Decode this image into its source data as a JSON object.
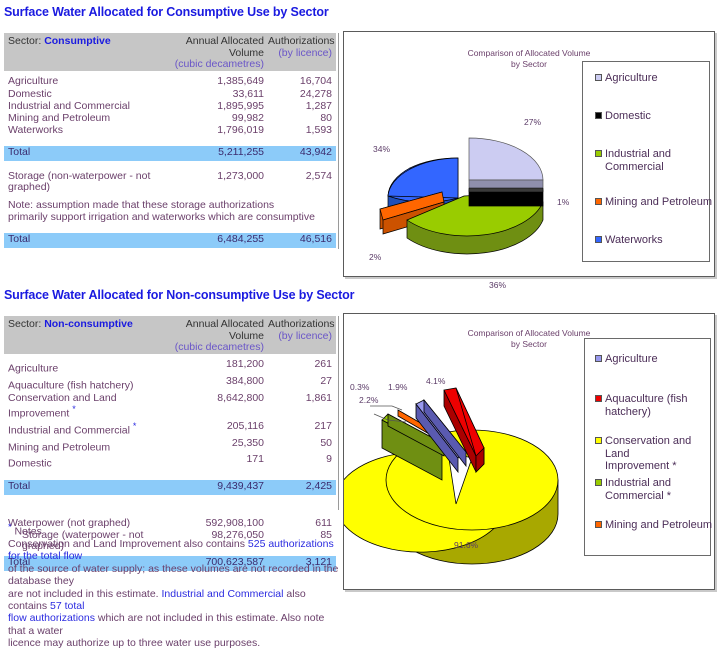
{
  "sections": [
    {
      "title": "Surface Water Allocated for Consumptive Use by Sector",
      "table": {
        "header": {
          "sector_label": "Sector:",
          "sector_value": "Consumptive",
          "col2_line1": "Annual Allocated Volume",
          "col2_line2": "(cubic decametres)",
          "col3_line1": "Authorizations",
          "col3_line2": "(by licence)"
        },
        "rows": [
          {
            "name": "Agriculture",
            "volume": "1,385,649",
            "auth": "16,704"
          },
          {
            "name": "Domestic",
            "volume": "33,611",
            "auth": "24,278"
          },
          {
            "name": "Industrial and Commercial",
            "volume": "1,895,995",
            "auth": "1,287"
          },
          {
            "name": "Mining and Petroleum",
            "volume": "99,982",
            "auth": "80"
          },
          {
            "name": "Waterworks",
            "volume": "1,796,019",
            "auth": "1,593"
          }
        ],
        "total1": {
          "name": "Total",
          "volume": "5,211,255",
          "auth": "43,942"
        },
        "storage": {
          "name": "Storage (non-waterpower - not graphed)",
          "volume": "1,273,000",
          "auth": "2,574"
        },
        "note_line1": "Note: assumption made that these storage authorizations",
        "note_line2": "primarily support irrigation and waterworks which are consumptive",
        "total2": {
          "name": "Total",
          "volume": "6,484,255",
          "auth": "46,516"
        }
      }
    },
    {
      "title": "Surface Water Allocated for Non-consumptive Use by Sector",
      "table": {
        "header": {
          "sector_label": "Sector:",
          "sector_value": "Non-consumptive",
          "col2_line1": "Annual Allocated Volume",
          "col2_line2": "(cubic decametres)",
          "col3_line1": "Authorizations",
          "col3_line2": "(by licence)"
        },
        "rows": [
          {
            "name": "Agriculture",
            "star": "",
            "volume": "181,200",
            "auth": "261"
          },
          {
            "name": "Aquaculture (fish hatchery)",
            "star": "",
            "volume": "384,800",
            "auth": "27"
          },
          {
            "name": "Conservation and Land Improvement",
            "star": "*",
            "volume": "8,642,800",
            "auth": "1,861"
          },
          {
            "name": "Industrial and Commercial",
            "star": "*",
            "volume": "205,116",
            "auth": "217"
          },
          {
            "name": "Mining and Petroleum",
            "star": "",
            "volume": "25,350",
            "auth": "50"
          },
          {
            "name": "Domestic",
            "star": "",
            "volume": "171",
            "auth": "9"
          }
        ],
        "total1": {
          "name": "Total",
          "volume": "9,439,437",
          "auth": "2,425"
        },
        "waterpower": {
          "name": "Waterpower (not graphed)",
          "volume": "592,908,100",
          "auth": "611"
        },
        "wp_storage": {
          "name": "Storage (waterpower - not graphed)",
          "volume": "98,276,050",
          "auth": "85"
        },
        "total2": {
          "name": "Total",
          "volume": "700,623,587",
          "auth": "3,121"
        }
      },
      "notes": {
        "heading_star": "*",
        "heading": "Notes",
        "p1a": "Conservation and Land Improvement also contains ",
        "p1b": "525 authorizations for the total flow",
        "p2a": "of the source of water supply; as these volumes are not recorded in the database they",
        "p3a": "are not included in this estimate. ",
        "p3b": "Industrial and Commercial",
        "p3c": " also contains ",
        "p3d": "57 total",
        "p4a": "flow authorizations",
        "p4b": " which are not included in this estimate. Also note that a water",
        "p5a": "licence may authorize up to three water use purposes."
      }
    }
  ],
  "chart_data": [
    {
      "type": "pie",
      "title": "Comparison of Allocated Volume",
      "subtitle": "by Sector",
      "categories": [
        "Agriculture",
        "Domestic",
        "Industrial and Commercial",
        "Mining and Petroleum",
        "Waterworks"
      ],
      "values": [
        1385649,
        33611,
        1895995,
        99982,
        1796019
      ],
      "labels": [
        "27%",
        "1%",
        "36%",
        "2%",
        "34%"
      ],
      "colors": [
        "#ccccf2",
        "#000000",
        "#99cc00",
        "#ff6600",
        "#3366ff"
      ],
      "legend_position": "right",
      "legend_entries": [
        {
          "label": "Agriculture",
          "color": "#ccccf2"
        },
        {
          "label": "Domestic",
          "color": "#000000"
        },
        {
          "label": "Industrial and\nCommercial",
          "color": "#99cc00"
        },
        {
          "label": "Mining and Petroleum",
          "color": "#ff6600"
        },
        {
          "label": "Waterworks",
          "color": "#3366ff"
        }
      ]
    },
    {
      "type": "pie",
      "title": "Comparison of Allocated Volume",
      "subtitle": "by Sector",
      "categories": [
        "Agriculture",
        "Aquaculture (fish hatchery)",
        "Conservation and Land Improvement *",
        "Industrial and Commercial *",
        "Mining and Petroleum"
      ],
      "values": [
        181200,
        384800,
        8642800,
        205116,
        25350
      ],
      "labels": [
        "1.9%",
        "4.1%",
        "91.6%",
        "2.2%",
        "0.3%"
      ],
      "colors": [
        "#9999ee",
        "#ee0000",
        "#ffff00",
        "#99cc00",
        "#ff6600"
      ],
      "legend_position": "right",
      "legend_entries": [
        {
          "label": "Agriculture",
          "color": "#9999ee"
        },
        {
          "label": "Aquaculture (fish\nhatchery)",
          "color": "#ee0000"
        },
        {
          "label": "Conservation and Land\nImprovement *",
          "color": "#ffff00"
        },
        {
          "label": "Industrial and\nCommercial *",
          "color": "#99cc00"
        },
        {
          "label": "Mining and Petroleum",
          "color": "#ff6600"
        }
      ]
    }
  ]
}
